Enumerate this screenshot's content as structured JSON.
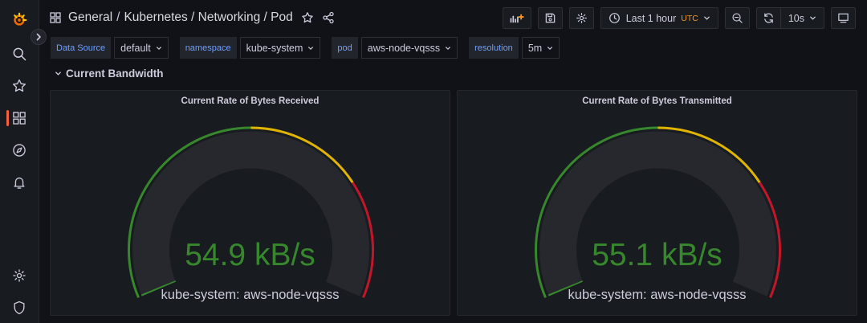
{
  "breadcrumb": {
    "folder": "General",
    "title": "Kubernetes / Networking / Pod"
  },
  "time_picker": {
    "label": "Last 1 hour",
    "tz": "UTC"
  },
  "refresh": {
    "interval": "10s"
  },
  "variables": [
    {
      "label": "Data Source",
      "value": "default"
    },
    {
      "label": "namespace",
      "value": "kube-system"
    },
    {
      "label": "pod",
      "value": "aws-node-vqsss"
    },
    {
      "label": "resolution",
      "value": "5m"
    }
  ],
  "row": {
    "title": "Current Bandwidth"
  },
  "panels": [
    {
      "title": "Current Rate of Bytes Received",
      "value": "54.9 kB/s",
      "series": "kube-system: aws-node-vqsss",
      "level": 0.0
    },
    {
      "title": "Current Rate of Bytes Transmitted",
      "value": "55.1 kB/s",
      "series": "kube-system: aws-node-vqsss",
      "level": 0.0
    }
  ],
  "colors": {
    "green": "#37872d",
    "yellow": "#e0b400",
    "red": "#c4162a",
    "accent": "#f55f3e",
    "track": "#26282e"
  },
  "icons": [
    "grafana-logo-icon",
    "search-icon",
    "star-icon",
    "dashboards-icon",
    "explore-icon",
    "alerting-icon",
    "configuration-icon",
    "shield-icon"
  ]
}
